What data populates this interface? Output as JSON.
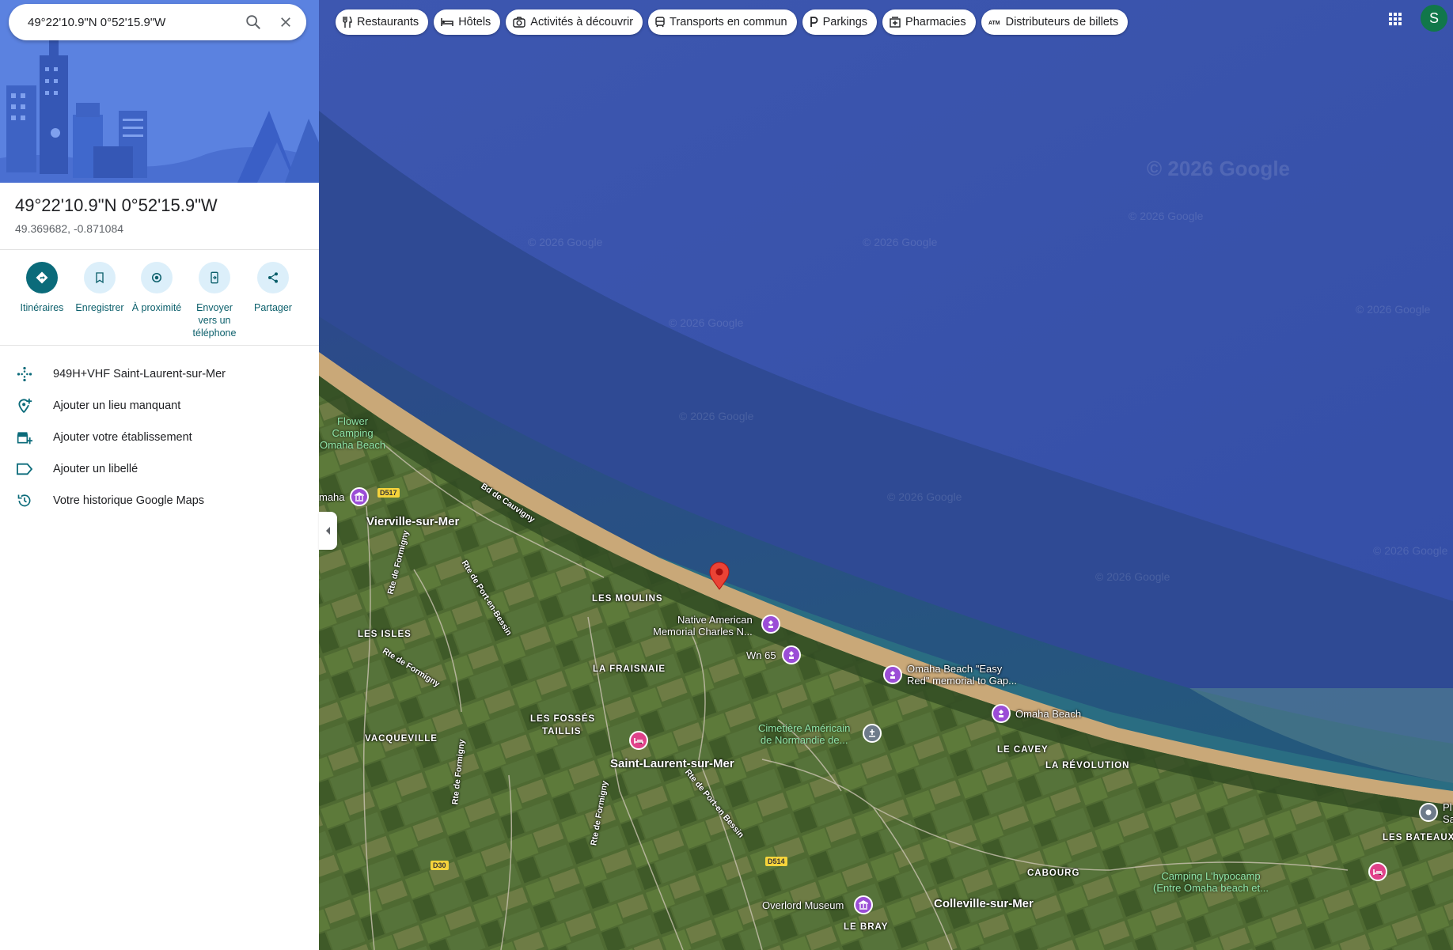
{
  "search": {
    "value": "49°22'10.9\"N 0°52'15.9\"W"
  },
  "place": {
    "title": "49°22'10.9\"N 0°52'15.9\"W",
    "coords": "49.369682, -0.871084"
  },
  "actions": [
    {
      "label": "Itinéraires",
      "icon": "directions-icon"
    },
    {
      "label": "Enregistrer",
      "icon": "bookmark-icon"
    },
    {
      "label": "À proximité",
      "icon": "nearby-icon"
    },
    {
      "label": "Envoyer vers un téléphone",
      "icon": "send-to-phone-icon"
    },
    {
      "label": "Partager",
      "icon": "share-icon"
    }
  ],
  "info": [
    {
      "text": "949H+VHF Saint-Laurent-sur-Mer",
      "icon": "plus-code-icon"
    },
    {
      "text": "Ajouter un lieu manquant",
      "icon": "add-place-icon"
    },
    {
      "text": "Ajouter votre établissement",
      "icon": "add-business-icon"
    },
    {
      "text": "Ajouter un libellé",
      "icon": "label-icon"
    },
    {
      "text": "Votre historique Google Maps",
      "icon": "history-icon"
    }
  ],
  "chips": [
    {
      "label": "Restaurants",
      "icon": "restaurant-icon"
    },
    {
      "label": "Hôtels",
      "icon": "hotel-icon"
    },
    {
      "label": "Activités à découvrir",
      "icon": "camera-icon"
    },
    {
      "label": "Transports en commun",
      "icon": "transit-icon"
    },
    {
      "label": "Parkings",
      "icon": "parking-icon"
    },
    {
      "label": "Pharmacies",
      "icon": "pharmacy-icon"
    },
    {
      "label": "Distributeurs de billets",
      "icon": "atm-icon"
    }
  ],
  "account": {
    "initial": "S"
  },
  "map": {
    "towns": [
      "Vierville-sur-Mer",
      "Saint-Laurent-sur-Mer",
      "Colleville-sur-Mer"
    ],
    "hamlets": [
      "LES MOULINS",
      "LES ISLES",
      "LA FRAISNAIE",
      "LES FOSSÉS",
      "TAILLIS",
      "VACQUEVILLE",
      "LE CAVEY",
      "LA RÉVOLUTION",
      "CABOURG",
      "LE BRAY",
      "LES BATEAUX"
    ],
    "pois": {
      "native_memorial": "Native American\nMemorial Charles N...",
      "wn65": "Wn 65",
      "easy_red": "Omaha Beach \"Easy\nRed\" memorial to Gap...",
      "omaha_beach": "Omaha Beach",
      "cemetery": "Cimetière Américain\nde Normandie de...",
      "overlord": "Overlord Museum",
      "flower_camping": "Flower\nCamping\nOmaha Beach",
      "camping_hypo": "Camping L'hypocamp\n(Entre Omaha beach et...",
      "omaha_left": "maha",
      "pl_right": "Pl\nSa"
    },
    "roads": [
      "Bd de Cauvigny",
      "Rte de Formigny",
      "Rte de Port-en-Bessin",
      "Rte de Formigny",
      "Rte de Formigny",
      "Rte de Port-en Bessin",
      "Rte de Formigny"
    ],
    "shields": [
      "D517",
      "D514",
      "D30"
    ],
    "watermark": "© 2026 Google"
  }
}
